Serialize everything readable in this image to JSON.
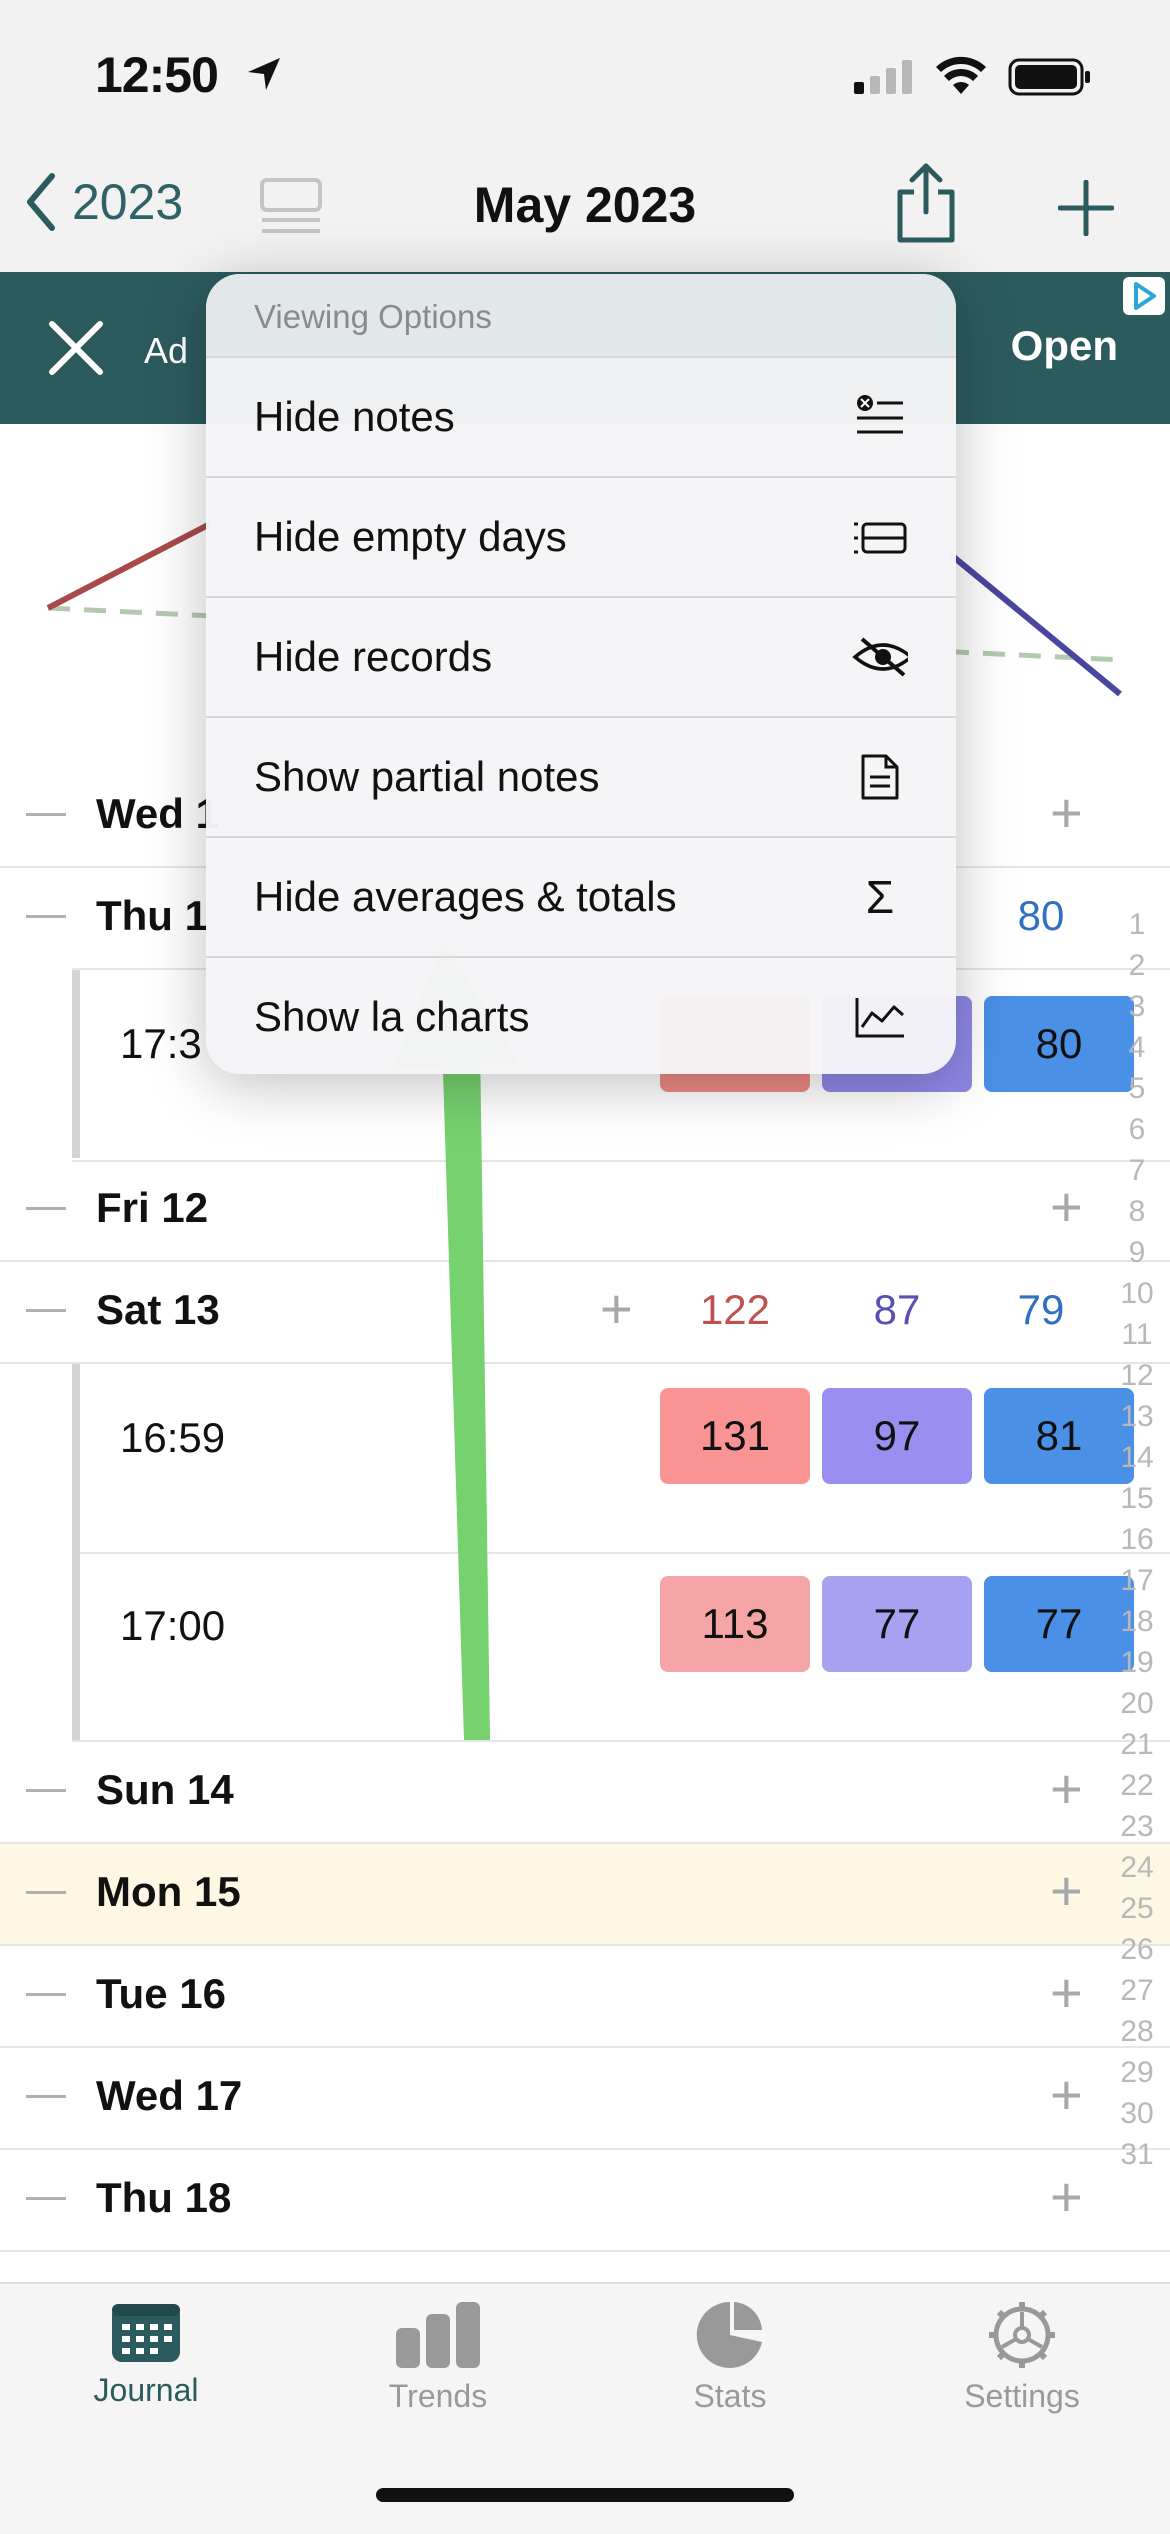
{
  "status": {
    "time": "12:50"
  },
  "nav": {
    "back_label": "2023",
    "title": "May 2023"
  },
  "ad": {
    "label": "Ad",
    "open_label": "Open"
  },
  "menu": {
    "header": "Viewing Options",
    "items": [
      {
        "label": "Hide notes",
        "icon": "notes-list-icon"
      },
      {
        "label": "Hide empty days",
        "icon": "rows-icon"
      },
      {
        "label": "Hide records",
        "icon": "eye-slash-icon"
      },
      {
        "label": "Show partial notes",
        "icon": "document-icon"
      },
      {
        "label": "Hide averages & totals",
        "icon": "sigma-icon"
      },
      {
        "label": "Show la charts",
        "icon": "line-chart-icon"
      }
    ]
  },
  "days": {
    "wed10": {
      "label": "Wed 1"
    },
    "thu11": {
      "label": "Thu 1",
      "avg3": "80"
    },
    "thu11_entry": {
      "time": "17:3",
      "c3": "80"
    },
    "fri12": {
      "label": "Fri 12"
    },
    "sat13": {
      "label": "Sat 13",
      "avg1": "122",
      "avg2": "87",
      "avg3": "79"
    },
    "sat13_e1": {
      "time": "16:59",
      "c1": "131",
      "c2": "97",
      "c3": "81"
    },
    "sat13_e2": {
      "time": "17:00",
      "c1": "113",
      "c2": "77",
      "c3": "77"
    },
    "sun14": {
      "label": "Sun 14"
    },
    "mon15": {
      "label": "Mon 15"
    },
    "tue16": {
      "label": "Tue 16"
    },
    "wed17": {
      "label": "Wed 17"
    },
    "thu18": {
      "label": "Thu 18"
    }
  },
  "side_index": [
    "1",
    "2",
    "3",
    "4",
    "5",
    "6",
    "7",
    "8",
    "9",
    "10",
    "11",
    "12",
    "13",
    "14",
    "15",
    "16",
    "17",
    "18",
    "19",
    "20",
    "21",
    "22",
    "23",
    "24",
    "25",
    "26",
    "27",
    "28",
    "29",
    "30",
    "31"
  ],
  "tabs": [
    {
      "label": "Journal",
      "icon": "calendar-icon"
    },
    {
      "label": "Trends",
      "icon": "bar-chart-icon"
    },
    {
      "label": "Stats",
      "icon": "pie-chart-icon"
    },
    {
      "label": "Settings",
      "icon": "gear-icon"
    }
  ],
  "colors": {
    "accent": "#2c5b5e",
    "systolic": "#c0504d",
    "diastolic": "#5a4fb5",
    "pulse": "#2f6fc4",
    "chip_red": "#f99b9b",
    "chip_purple": "#9a8ff0",
    "chip_blue": "#4a90e6",
    "arrow_green": "#76d16f",
    "today_highlight": "#fdf7e3"
  }
}
